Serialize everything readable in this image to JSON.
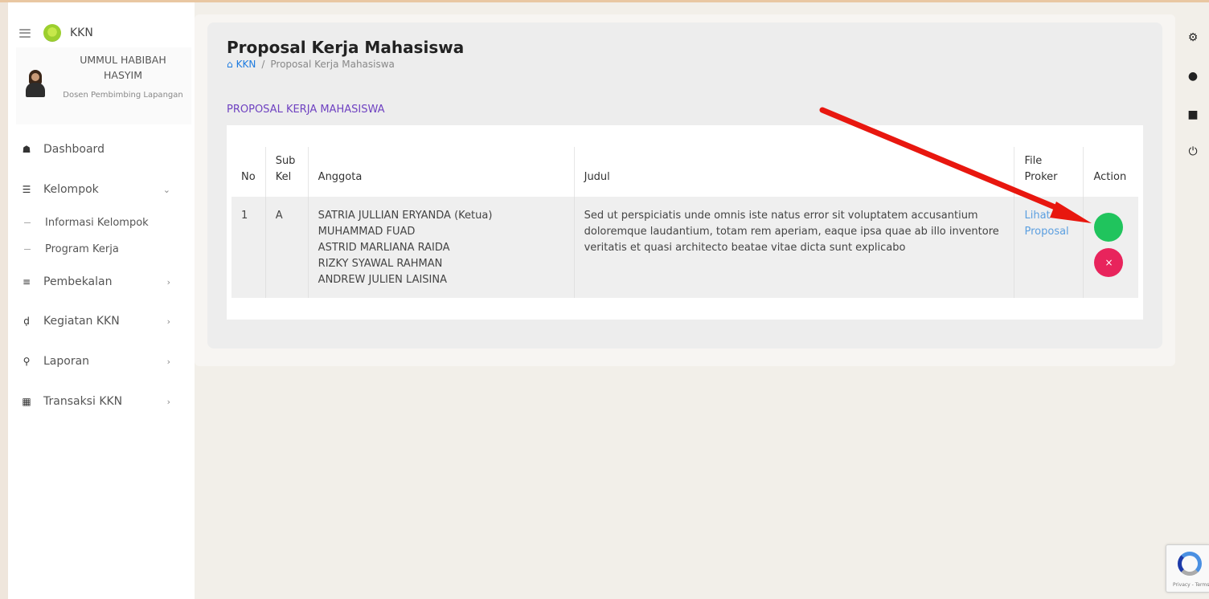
{
  "app": {
    "name": "KKN"
  },
  "profile": {
    "name": "UMMUL HABIBAH HASYIM",
    "role": "Dosen Pembimbing Lapangan"
  },
  "sidebar": {
    "items": [
      {
        "label": "Dashboard",
        "icon": "home-icon"
      },
      {
        "label": "Kelompok",
        "icon": "group-icon",
        "expanded": true
      },
      {
        "label": "Pembekalan",
        "icon": "layers-icon"
      },
      {
        "label": "Kegiatan KKN",
        "icon": "activity-icon"
      },
      {
        "label": "Laporan",
        "icon": "search-report-icon"
      },
      {
        "label": "Transaksi KKN",
        "icon": "book-icon"
      }
    ],
    "sub_items": [
      {
        "label": "Informasi Kelompok"
      },
      {
        "label": "Program Kerja"
      }
    ]
  },
  "page": {
    "title": "Proposal Kerja Mahasiswa",
    "breadcrumb": {
      "root": "KKN",
      "current": "Proposal Kerja Mahasiswa"
    },
    "section_title": "PROPOSAL KERJA MAHASISWA"
  },
  "table": {
    "headers": {
      "no": "No",
      "subkel": "Sub Kel",
      "anggota": "Anggota",
      "judul": "Judul",
      "file": "File Proker",
      "action": "Action"
    },
    "rows": [
      {
        "no": "1",
        "subkel": "A",
        "ketua": "SATRIA JULLIAN ERYANDA (Ketua)",
        "members": [
          "MUHAMMAD FUAD",
          "ASTRID MARLIANA RAIDA",
          "RIZKY SYAWAL RAHMAN",
          "ANDREW JULIEN LAISINA"
        ],
        "judul": "Sed ut perspiciatis unde omnis iste natus error sit voluptatem accusantium doloremque laudantium, totam rem aperiam, eaque ipsa quae ab illo inventore veritatis et quasi architecto beatae vitae dicta sunt explicabo",
        "file_link": "Lihat Proposal",
        "reject_symbol": "×"
      }
    ]
  },
  "colors": {
    "approve": "#20c45d",
    "reject": "#e8245c",
    "annotation_arrow": "#e8170f",
    "section_title": "#6f42c1",
    "ketua": "#e04848"
  }
}
